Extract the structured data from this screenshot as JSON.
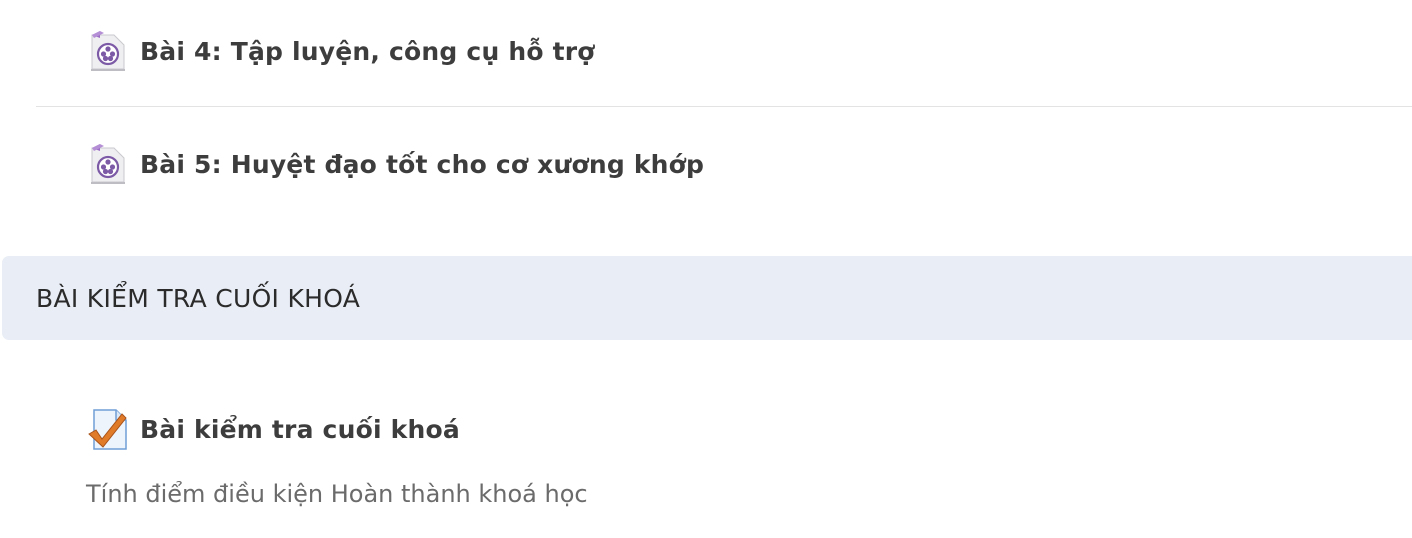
{
  "activities": [
    {
      "title": "Bài 4: Tập luyện, công cụ hỗ trợ",
      "icon": "video-file-icon"
    },
    {
      "title": "Bài 5: Huyệt đạo tốt cho cơ xương khớp",
      "icon": "video-file-icon"
    }
  ],
  "section": {
    "title": "BÀI KIỂM TRA CUỐI KHOÁ",
    "background_color": "#e9edf5"
  },
  "quiz": {
    "title": "Bài kiểm tra cuối khoá",
    "icon": "quiz-checkmark-icon",
    "description": "Tính điểm điều kiện Hoàn thành khoá học"
  },
  "colors": {
    "link_text": "#3d3d3d",
    "description_text": "#6b6b6b",
    "checkmark": "#e07b2a",
    "video_icon_purple": "#8a5fb0"
  }
}
